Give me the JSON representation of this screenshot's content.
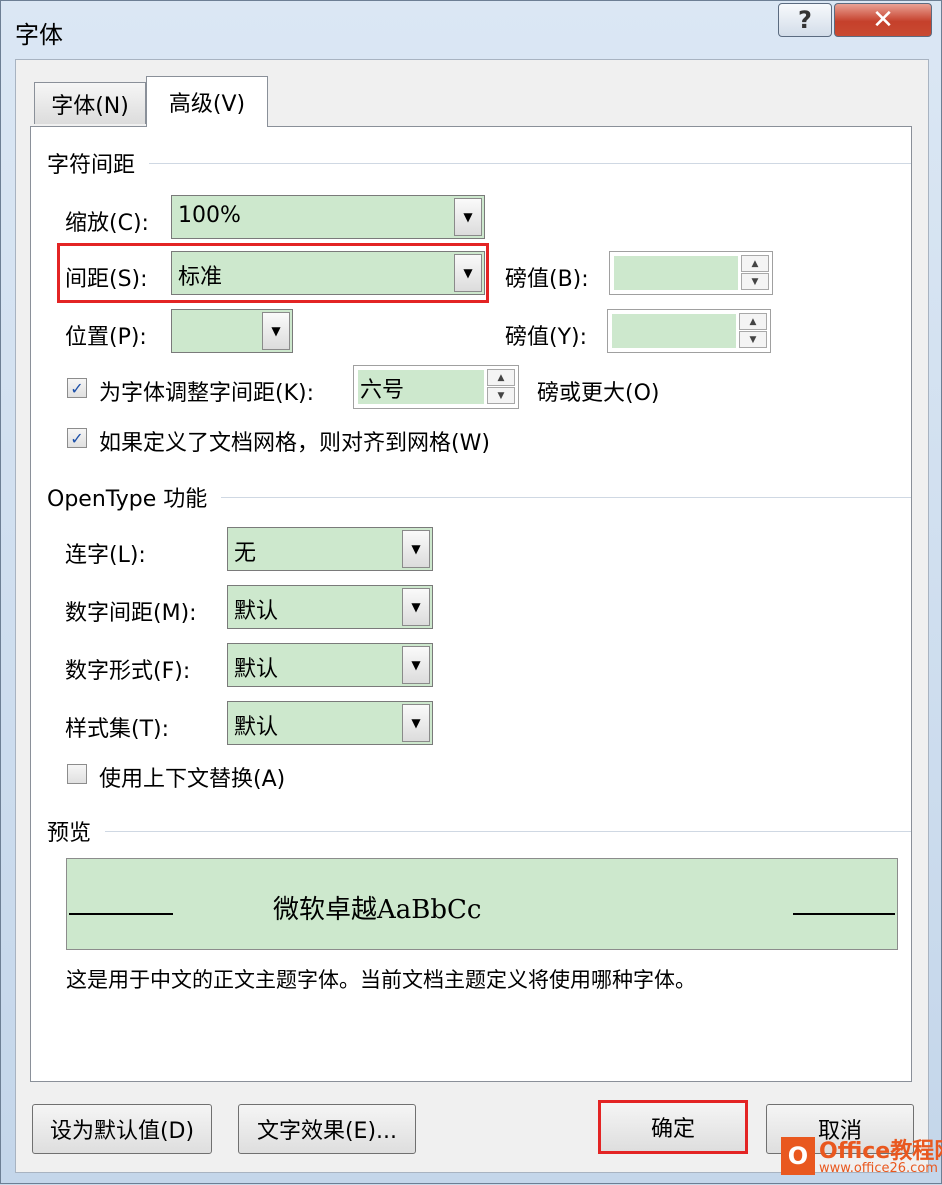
{
  "window": {
    "title": "字体",
    "help_label": "?",
    "close_label": "✕"
  },
  "tabs": [
    {
      "label": "字体(N)"
    },
    {
      "label": "高级(V)"
    }
  ],
  "char_spacing": {
    "heading": "字符间距",
    "scale": {
      "label": "缩放(C):",
      "value": "100%"
    },
    "spacing": {
      "label": "间距(S):",
      "value": "标准"
    },
    "spacing_by": {
      "label": "磅值(B):",
      "value": ""
    },
    "position": {
      "label": "位置(P):",
      "value": ""
    },
    "position_by": {
      "label": "磅值(Y):",
      "value": ""
    },
    "kerning": {
      "label": "为字体调整字间距(K):",
      "checked": true,
      "value": "六号",
      "suffix": "磅或更大(O)"
    },
    "snap_grid": {
      "label": "如果定义了文档网格，则对齐到网格(W)",
      "checked": true
    }
  },
  "opentype": {
    "heading": "OpenType 功能",
    "ligatures": {
      "label": "连字(L):",
      "value": "无"
    },
    "number_spacing": {
      "label": "数字间距(M):",
      "value": "默认"
    },
    "number_forms": {
      "label": "数字形式(F):",
      "value": "默认"
    },
    "stylistic_sets": {
      "label": "样式集(T):",
      "value": "默认"
    },
    "contextual_alternates": {
      "label": "使用上下文替换(A)",
      "checked": false
    }
  },
  "preview": {
    "heading": "预览",
    "sample": "微软卓越AaBbCc",
    "description": "这是用于中文的正文主题字体。当前文档主题定义将使用哪种字体。"
  },
  "buttons": {
    "set_default": "设为默认值(D)",
    "text_effects": "文字效果(E)...",
    "ok": "确定",
    "cancel": "取消"
  },
  "watermark": {
    "brand": "Office教程网",
    "url": "www.office26.com"
  },
  "colors": {
    "highlight": "#e32424",
    "field_fill": "#cde8cd",
    "brand_orange": "#e9581f"
  }
}
